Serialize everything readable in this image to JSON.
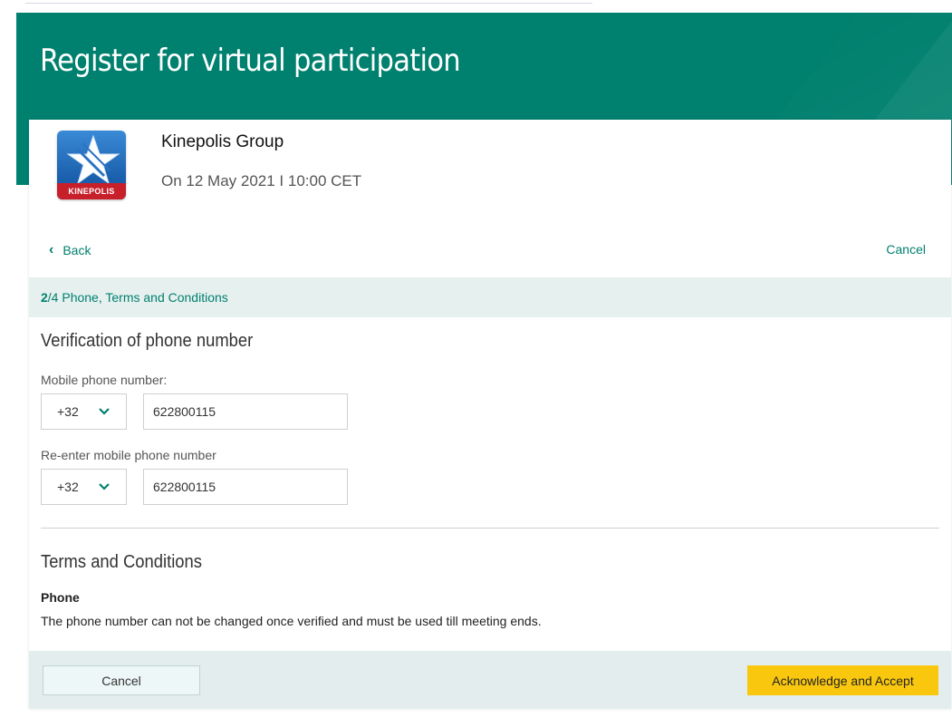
{
  "page": {
    "title": "Register for virtual participation"
  },
  "event": {
    "company": "Kinepolis Group",
    "datetime": "On 12 May 2021 I 10:00 CET",
    "logo_text": "KINEPOLIS"
  },
  "nav": {
    "back_label": "Back",
    "cancel_label": "Cancel"
  },
  "step": {
    "current": "2",
    "total_and_title": "/4 Phone, Terms and Conditions"
  },
  "phone_section": {
    "title": "Verification of phone number",
    "mobile_label": "Mobile phone number:",
    "mobile_country_code": "+32",
    "mobile_value": "622800115",
    "reenter_label": "Re-enter mobile phone number",
    "reenter_country_code": "+32",
    "reenter_value": "622800115"
  },
  "terms_section": {
    "title": "Terms and Conditions",
    "item_heading": "Phone",
    "item_text": "The phone number can not be changed once verified and must be used till meeting ends."
  },
  "footer": {
    "cancel_label": "Cancel",
    "accept_label": "Acknowledge and Accept"
  },
  "colors": {
    "brand_green": "#00806e",
    "accept_yellow": "#f9c80e",
    "step_bar_bg": "#e6f0ef"
  },
  "icons": {
    "back": "chevron-left-icon",
    "dropdown": "chevron-down-icon",
    "logo": "kinepolis-star-logo"
  }
}
